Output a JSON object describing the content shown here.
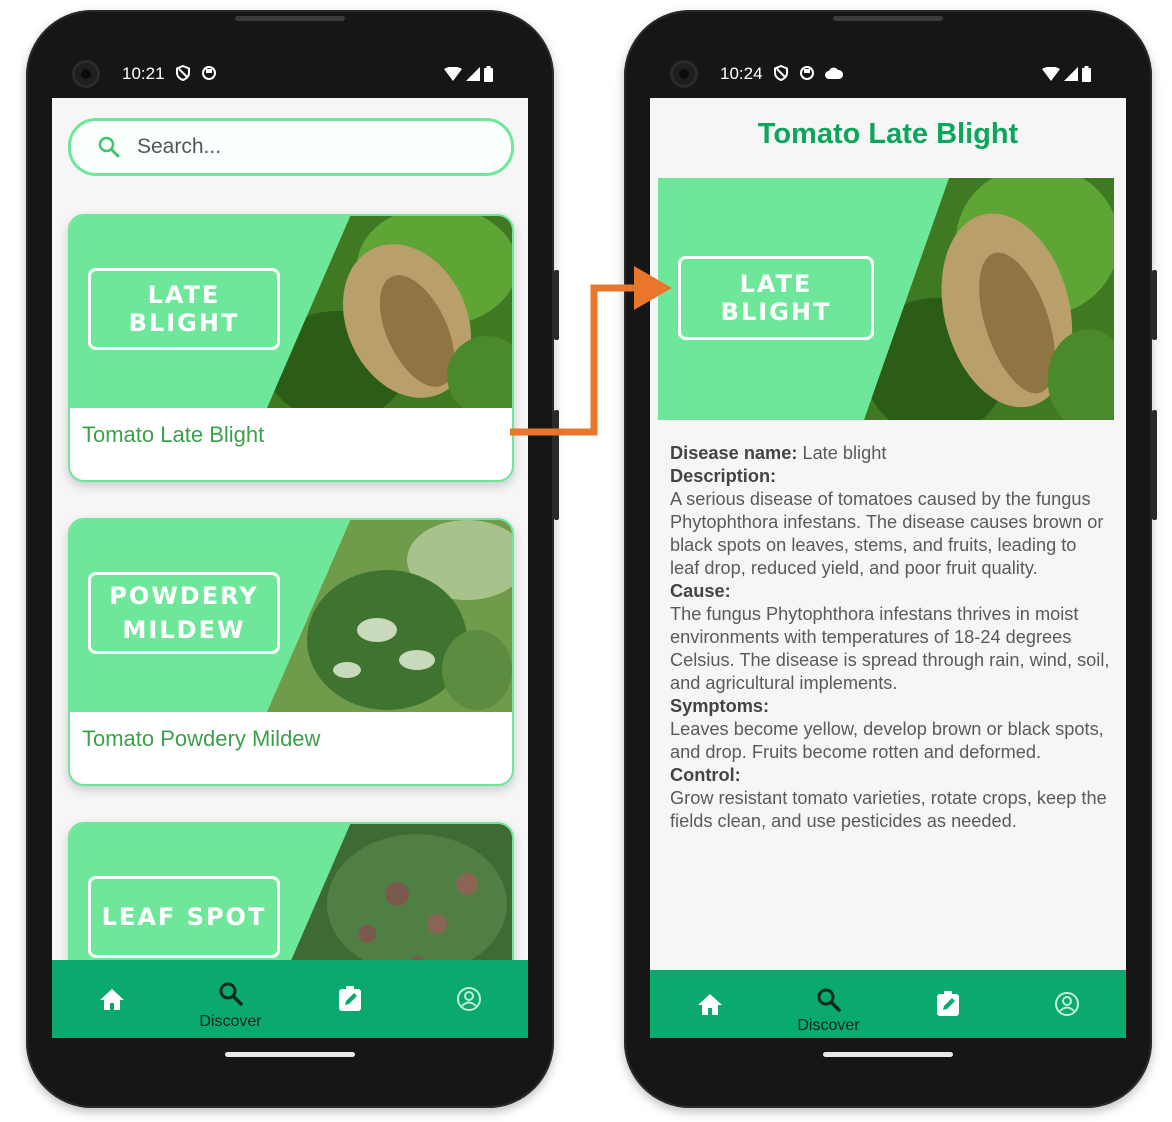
{
  "left_phone": {
    "status": {
      "time": "10:21"
    },
    "search": {
      "placeholder": "Search..."
    },
    "cards": [
      {
        "badge": "LATE BLIGHT",
        "title": "Tomato Late Blight"
      },
      {
        "badge_line1": "POWDERY",
        "badge_line2": "MILDEW",
        "title": "Tomato Powdery Mildew"
      },
      {
        "badge": "LEAF SPOT"
      }
    ],
    "nav": {
      "discover_label": "Discover"
    }
  },
  "right_phone": {
    "status": {
      "time": "10:24"
    },
    "title": "Tomato Late Blight",
    "badge": "LATE BLIGHT",
    "disease_label": "Disease name:",
    "disease_name": "Late blight",
    "description_label": "Description:",
    "description": "A serious disease of tomatoes caused by the fungus Phytophthora infestans. The disease causes brown or black spots on leaves, stems, and fruits, leading to leaf drop, reduced yield, and poor fruit quality.",
    "cause_label": "Cause:",
    "cause": "The fungus Phytophthora infestans thrives in moist environments with temperatures of 18-24 degrees Celsius. The disease is spread through rain, wind, soil, and agricultural implements.",
    "symptoms_label": "Symptoms:",
    "symptoms": "Leaves become yellow, develop brown or black spots, and drop. Fruits become rotten and deformed.",
    "control_label": "Control:",
    "control": "Grow resistant tomato varieties, rotate crops, keep the fields clean, and use pesticides as needed.",
    "nav": {
      "discover_label": "Discover"
    }
  },
  "colors": {
    "accent_green": "#6fe79b",
    "nav_green": "#0aa96d",
    "title_green": "#0aa65b",
    "card_title_green": "#3ca04a",
    "arrow_orange": "#e9762b"
  }
}
